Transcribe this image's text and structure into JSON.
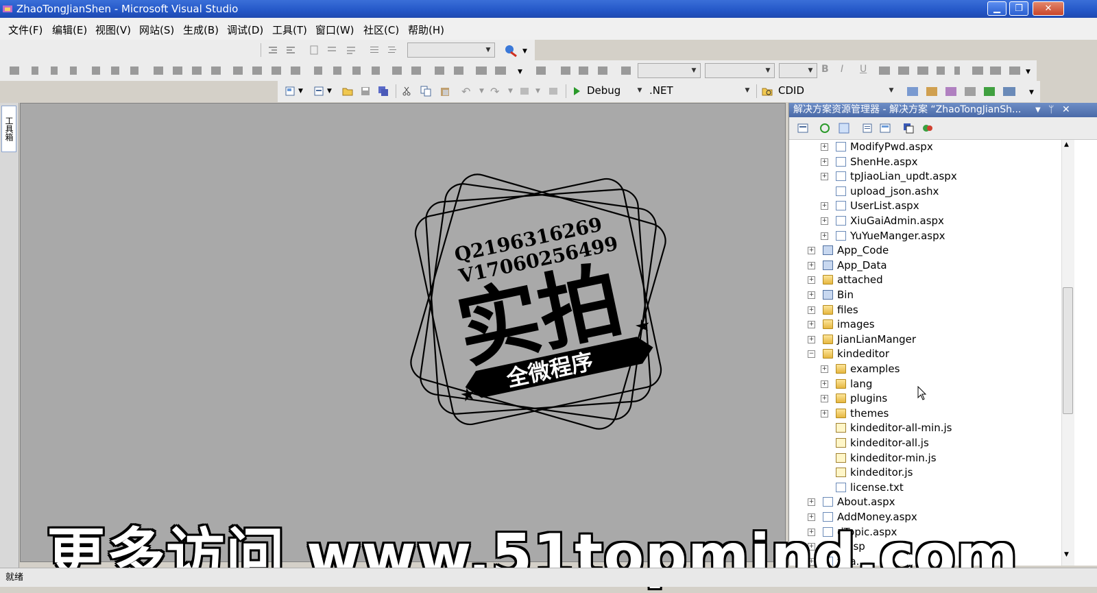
{
  "window": {
    "title": "ZhaoTongJianShen - Microsoft Visual Studio",
    "controls": {
      "minimize": "▁",
      "restore": "❐",
      "close": "✕"
    }
  },
  "menu": [
    "文件(F)",
    "编辑(E)",
    "视图(V)",
    "网站(S)",
    "生成(B)",
    "调试(D)",
    "工具(T)",
    "窗口(W)",
    "社区(C)",
    "帮助(H)"
  ],
  "toolbar_standard": {
    "config": "Debug",
    "platform": ".NET",
    "find": "CDID"
  },
  "toolbox_tab": "工具箱",
  "solution_explorer": {
    "title": "解决方案资源管理器 - 解决方案 “ZhaoTongJianSh...",
    "items": [
      {
        "label": "ModifyPwd.aspx",
        "type": "page",
        "level": 2,
        "expand": "+"
      },
      {
        "label": "ShenHe.aspx",
        "type": "page",
        "level": 2,
        "expand": "+"
      },
      {
        "label": "tpJiaoLian_updt.aspx",
        "type": "page",
        "level": 2,
        "expand": "+"
      },
      {
        "label": "upload_json.ashx",
        "type": "page",
        "level": 2,
        "expand": ""
      },
      {
        "label": "UserList.aspx",
        "type": "page",
        "level": 2,
        "expand": "+"
      },
      {
        "label": "XiuGaiAdmin.aspx",
        "type": "page",
        "level": 2,
        "expand": "+"
      },
      {
        "label": "YuYueManger.aspx",
        "type": "page",
        "level": 2,
        "expand": "+"
      },
      {
        "label": "App_Code",
        "type": "special",
        "level": 1,
        "expand": "+"
      },
      {
        "label": "App_Data",
        "type": "special",
        "level": 1,
        "expand": "+"
      },
      {
        "label": "attached",
        "type": "folder",
        "level": 1,
        "expand": "+"
      },
      {
        "label": "Bin",
        "type": "special",
        "level": 1,
        "expand": "+"
      },
      {
        "label": "files",
        "type": "folder",
        "level": 1,
        "expand": "+"
      },
      {
        "label": "images",
        "type": "folder",
        "level": 1,
        "expand": "+"
      },
      {
        "label": "JianLianManger",
        "type": "folder",
        "level": 1,
        "expand": "+"
      },
      {
        "label": "kindeditor",
        "type": "folder",
        "level": 1,
        "expand": "−"
      },
      {
        "label": "examples",
        "type": "folder",
        "level": 2,
        "expand": "+"
      },
      {
        "label": "lang",
        "type": "folder",
        "level": 2,
        "expand": "+"
      },
      {
        "label": "plugins",
        "type": "folder",
        "level": 2,
        "expand": "+"
      },
      {
        "label": "themes",
        "type": "folder",
        "level": 2,
        "expand": "+"
      },
      {
        "label": "kindeditor-all-min.js",
        "type": "script",
        "level": 2,
        "expand": ""
      },
      {
        "label": "kindeditor-all.js",
        "type": "script",
        "level": 2,
        "expand": ""
      },
      {
        "label": "kindeditor-min.js",
        "type": "script",
        "level": 2,
        "expand": ""
      },
      {
        "label": "kindeditor.js",
        "type": "script",
        "level": 2,
        "expand": ""
      },
      {
        "label": "license.txt",
        "type": "page",
        "level": 2,
        "expand": ""
      },
      {
        "label": "About.aspx",
        "type": "page",
        "level": 1,
        "expand": "+"
      },
      {
        "label": "AddMoney.aspx",
        "type": "page",
        "level": 1,
        "expand": "+"
      },
      {
        "label": "dTopic.aspx",
        "type": "page",
        "level": 1,
        "expand": "+"
      },
      {
        "label": "S.asp",
        "type": "page",
        "level": 1,
        "expand": "+"
      },
      {
        "label": "f...a...",
        "type": "page",
        "level": 1,
        "expand": "+"
      }
    ]
  },
  "watermark": {
    "stamp_line1": "Q2196316269",
    "stamp_line2": "V17060256499",
    "stamp_main": "实拍",
    "stamp_banner": "全微程序",
    "bottom_text": "更多访问 www.51topmind.com"
  },
  "status": "就绪",
  "colors": {
    "titlebar": "#2457c7",
    "editor_bg": "#a9a9a9",
    "se_header": "#5a7ab8"
  }
}
